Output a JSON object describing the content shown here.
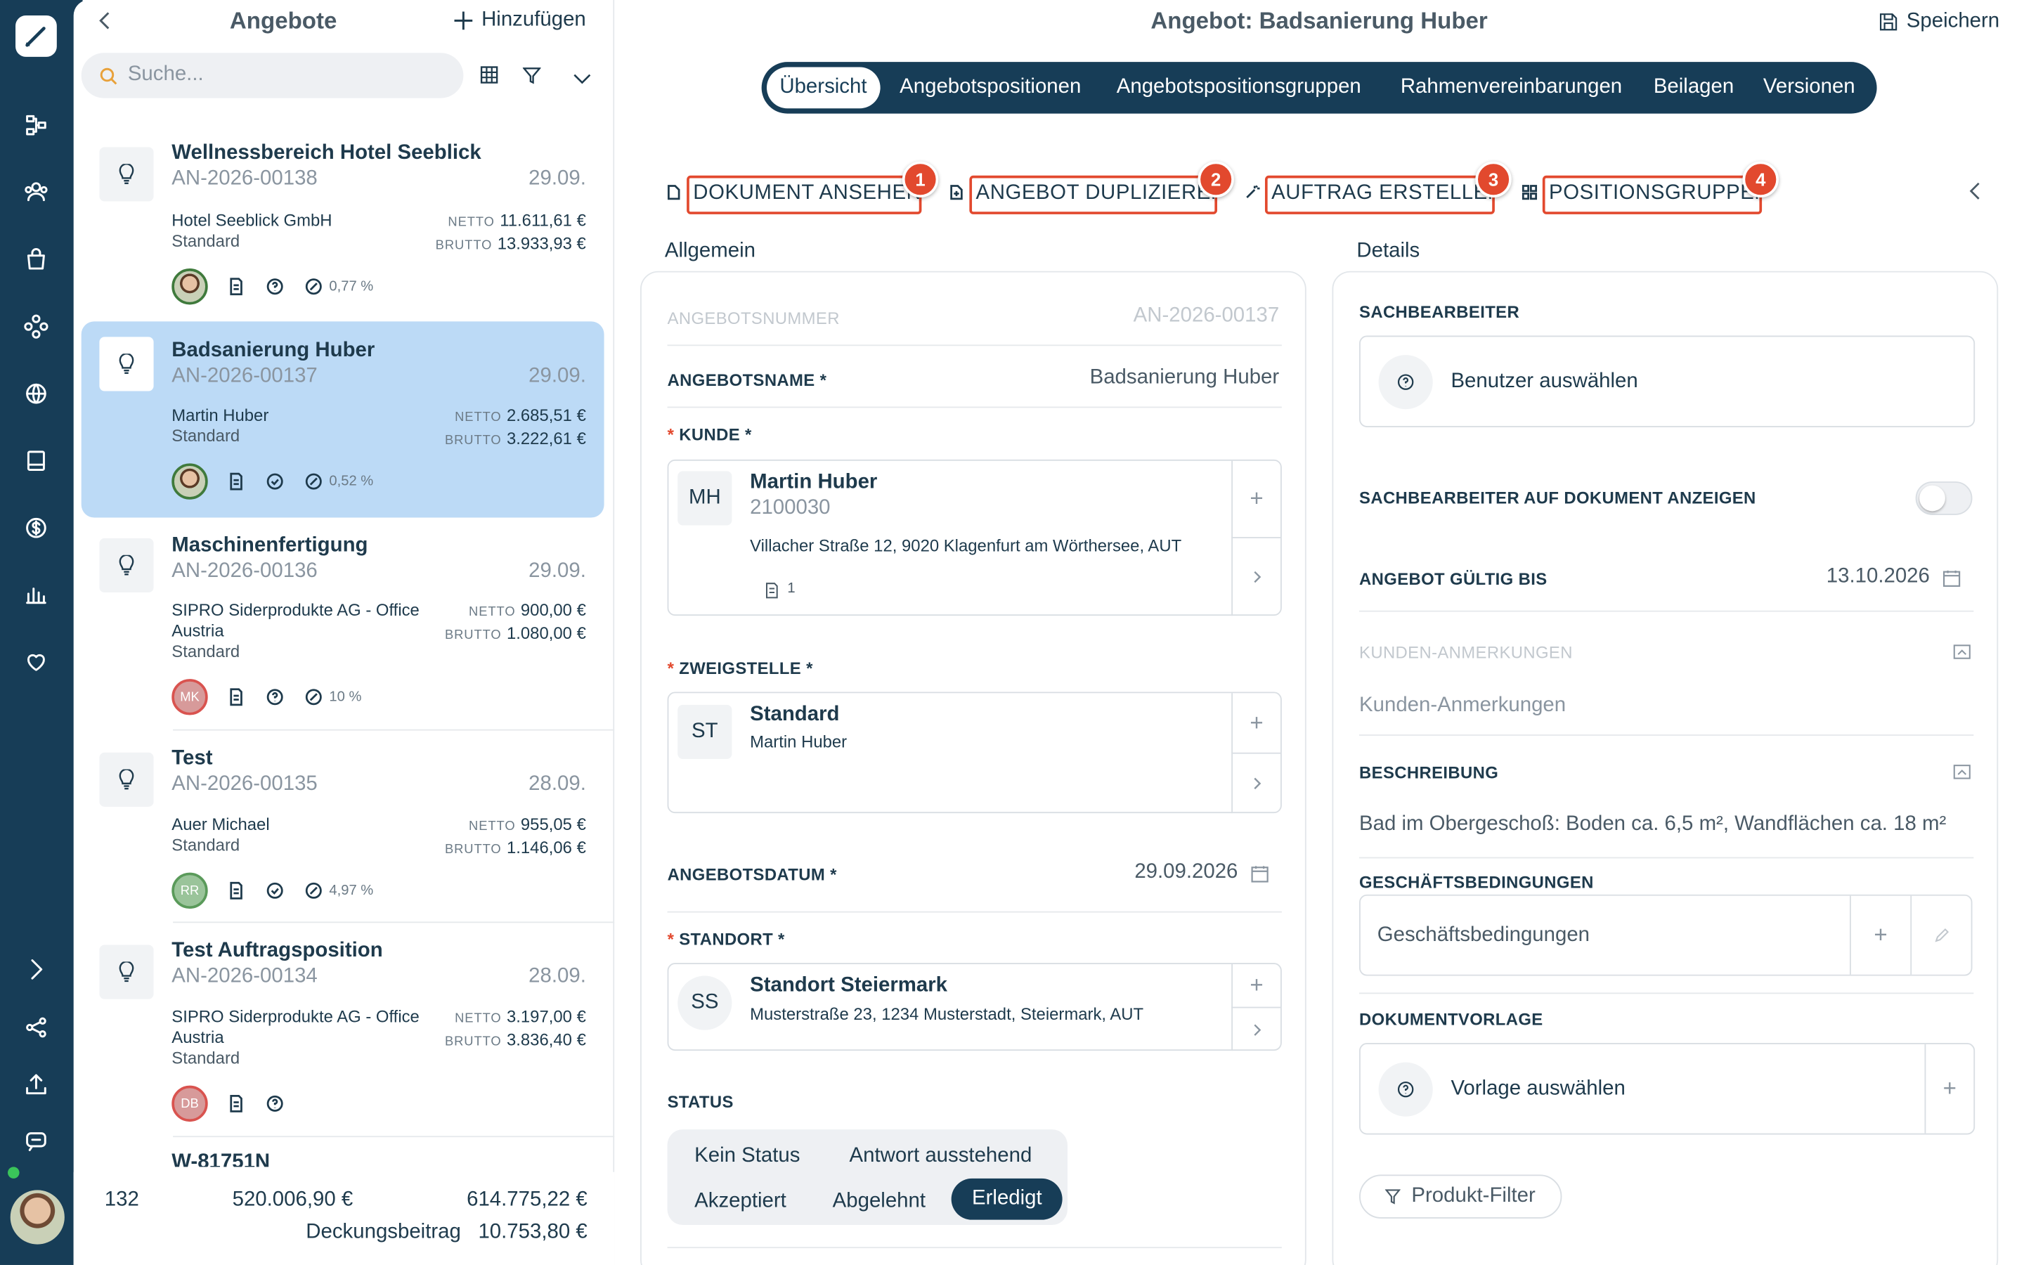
{
  "list": {
    "title": "Angebote",
    "add_label": "Hinzufügen",
    "search_placeholder": "Suche...",
    "items": [
      {
        "title": "Wellnessbereich Hotel Seeblick",
        "number": "AN-2026-00138",
        "date": "29.09.",
        "customer": [
          "Hotel Seeblick GmbH"
        ],
        "type": "Standard",
        "netto": "11.611,61 €",
        "brutto": "13.933,93 €",
        "avatar": "",
        "status_icon": "help-circle-icon",
        "percent": "0,77 %",
        "selected": false
      },
      {
        "title": "Badsanierung Huber",
        "number": "AN-2026-00137",
        "date": "29.09.",
        "customer": [
          "Martin Huber"
        ],
        "type": "Standard",
        "netto": "2.685,51 €",
        "brutto": "3.222,61 €",
        "avatar": "",
        "status_icon": "check-circle-icon",
        "percent": "0,52 %",
        "selected": true
      },
      {
        "title": "Maschinenfertigung",
        "number": "AN-2026-00136",
        "date": "29.09.",
        "customer": [
          "SIPRO Siderprodukte AG - Office",
          "Austria"
        ],
        "type": "Standard",
        "netto": "900,00 €",
        "brutto": "1.080,00 €",
        "avatar": "MK",
        "status_icon": "help-circle-icon",
        "percent": "10 %",
        "selected": false
      },
      {
        "title": "Test",
        "number": "AN-2026-00135",
        "date": "28.09.",
        "customer": [
          "Auer Michael"
        ],
        "type": "Standard",
        "netto": "955,05 €",
        "brutto": "1.146,06 €",
        "avatar": "RR",
        "status_icon": "check-circle-icon",
        "percent": "4,97 %",
        "selected": false
      },
      {
        "title": "Test Auftragsposition",
        "number": "AN-2026-00134",
        "date": "28.09.",
        "customer": [
          "SIPRO Siderprodukte AG - Office",
          "Austria"
        ],
        "type": "Standard",
        "netto": "3.197,00 €",
        "brutto": "3.836,40 €",
        "avatar": "DB",
        "status_icon": "help-circle-icon",
        "percent": "",
        "selected": false
      }
    ],
    "next_title_partial": "W-81751N",
    "netto_label": "NETTO",
    "brutto_label": "BRUTTO",
    "footer": {
      "count": "132",
      "netto_sum": "520.006,90 €",
      "brutto_sum": "614.775,22 €",
      "db_label": "Deckungsbeitrag",
      "db_value": "10.753,80 €"
    }
  },
  "header": {
    "title": "Angebot: Badsanierung Huber",
    "save_label": "Speichern"
  },
  "tabs": [
    "Übersicht",
    "Angebotspositionen",
    "Angebotspositionsgruppen",
    "Rahmenvereinbarungen",
    "Beilagen",
    "Versionen"
  ],
  "actions": [
    {
      "label": "DOKUMENT ANSEHEN",
      "badge": "1"
    },
    {
      "label": "ANGEBOT DUPLIZIEREN",
      "badge": "2"
    },
    {
      "label": "AUFTRAG ERSTELLEN",
      "badge": "3"
    },
    {
      "label": "POSITIONSGRUPPEN",
      "badge": "4"
    }
  ],
  "general": {
    "section_title": "Allgemein",
    "offer_number_label": "ANGEBOTSNUMMER",
    "offer_number": "AN-2026-00137",
    "offer_name_label": "ANGEBOTSNAME *",
    "offer_name": "Badsanierung Huber",
    "customer_label": "KUNDE *",
    "customer": {
      "initials": "MH",
      "name": "Martin Huber",
      "number": "2100030",
      "address": "Villacher Straße 12, 9020 Klagenfurt am Wörthersee, AUT",
      "doc_count": "1"
    },
    "branch_label": "ZWEIGSTELLE *",
    "branch": {
      "initials": "ST",
      "name": "Standard",
      "person": "Martin Huber"
    },
    "offer_date_label": "ANGEBOTSDATUM *",
    "offer_date": "29.09.2026",
    "location_label": "STANDORT *",
    "location": {
      "initials": "SS",
      "name": "Standort Steiermark",
      "address": "Musterstraße 23, 1234 Musterstadt, Steiermark, AUT"
    },
    "status_label": "STATUS",
    "status_options": [
      "Kein Status",
      "Antwort ausstehend",
      "Akzeptiert",
      "Abgelehnt",
      "Erledigt"
    ],
    "status_selected": "Erledigt"
  },
  "details": {
    "section_title": "Details",
    "clerk_label": "SACHBEARBEITER",
    "clerk_placeholder": "Benutzer auswählen",
    "show_clerk_label": "SACHBEARBEITER AUF DOKUMENT ANZEIGEN",
    "show_clerk_on": false,
    "valid_until_label": "ANGEBOT GÜLTIG BIS",
    "valid_until": "13.10.2026",
    "customer_notes_label": "KUNDEN-ANMERKUNGEN",
    "customer_notes_placeholder": "Kunden-Anmerkungen",
    "description_label": "BESCHREIBUNG",
    "description": "Bad im Obergeschoß: Boden ca. 6,5 m², Wandflächen ca. 18 m²",
    "terms_label": "GESCHÄFTSBEDINGUNGEN",
    "terms_placeholder": "Geschäftsbedingungen",
    "template_label": "DOKUMENTVORLAGE",
    "template_placeholder": "Vorlage auswählen",
    "product_filter_label": "Produkt-Filter"
  },
  "colors": {
    "primary": "#173d57",
    "accent": "#e2492e",
    "selected": "#bcdaf6"
  }
}
